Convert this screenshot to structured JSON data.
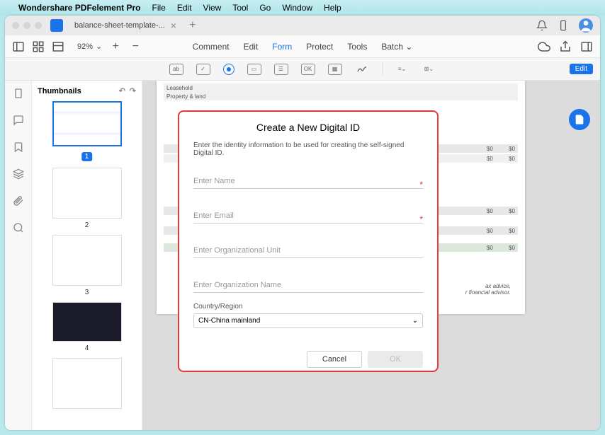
{
  "menubar": {
    "appname": "Wondershare PDFelement Pro",
    "items": [
      "File",
      "Edit",
      "View",
      "Tool",
      "Go",
      "Window",
      "Help"
    ]
  },
  "titlebar": {
    "tab_title": "balance-sheet-template-..."
  },
  "toolbar1": {
    "zoom": "92%",
    "tabs": [
      "Comment",
      "Edit",
      "Form",
      "Protect",
      "Tools",
      "Batch"
    ],
    "active_tab": "Form"
  },
  "toolbar2": {
    "edit_label": "Edit"
  },
  "thumbnails": {
    "title": "Thumbnails",
    "pages": [
      "1",
      "2",
      "3",
      "4"
    ],
    "selected": "1"
  },
  "doc": {
    "lines": [
      {
        "label": "Leasehold",
        "v1": "",
        "v2": ""
      },
      {
        "label": "Property & land",
        "v1": "",
        "v2": ""
      },
      {
        "label": "",
        "v1": "$0",
        "v2": "$0"
      },
      {
        "label": "",
        "v1": "$0",
        "v2": "$0"
      },
      {
        "label": "",
        "v1": "$0",
        "v2": "$0"
      },
      {
        "label": "",
        "v1": "$0",
        "v2": "$0"
      }
    ],
    "footer1": "ax advice,",
    "footer2": "r financial advisor."
  },
  "modal": {
    "title": "Create a New Digital ID",
    "desc": "Enter the identity information to be used for creating the self-signed Digital ID.",
    "name_ph": "Enter Name",
    "email_ph": "Enter Email",
    "orgunit_ph": "Enter Organizational Unit",
    "orgname_ph": "Enter Organization Name",
    "country_label": "Country/Region",
    "country_value": "CN-China mainland",
    "cancel": "Cancel",
    "ok": "OK"
  }
}
